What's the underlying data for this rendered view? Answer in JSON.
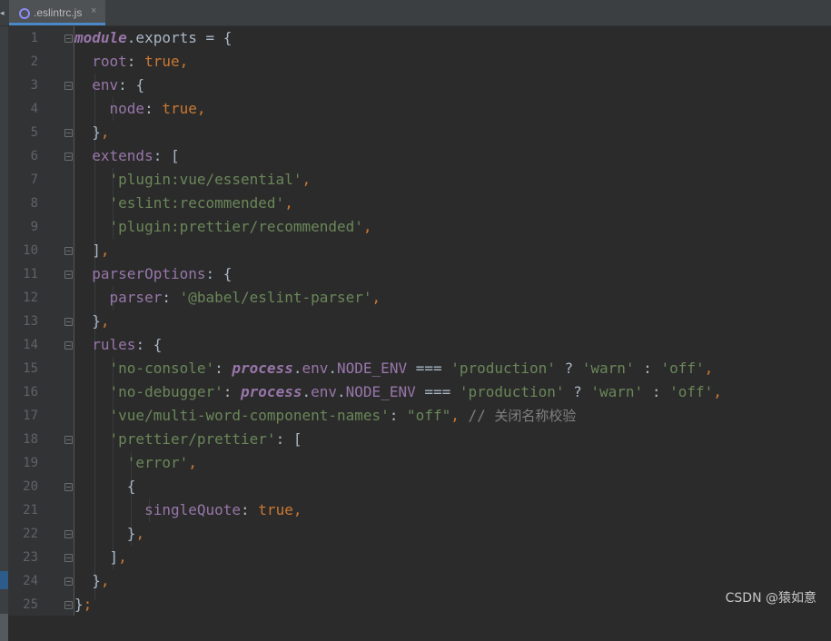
{
  "tab": {
    "filename": ".eslintrc.js",
    "close": "×",
    "icon": "eslint-config-icon"
  },
  "watermark": "CSDN @猿如意",
  "colors": {
    "keyword": "#cc7832",
    "string": "#6a8759",
    "property": "#9876aa",
    "text": "#a9b7c6",
    "comment": "#808080",
    "background": "#2b2b2b"
  },
  "code": {
    "line_numbers": [
      "1",
      "2",
      "3",
      "4",
      "5",
      "6",
      "7",
      "8",
      "9",
      "10",
      "11",
      "12",
      "13",
      "14",
      "15",
      "16",
      "17",
      "18",
      "19",
      "20",
      "21",
      "22",
      "23",
      "24",
      "25"
    ],
    "l1": {
      "obj": "module",
      "rest": ".exports = {"
    },
    "l2": {
      "key": "root",
      "colon": ": ",
      "val": "true",
      "comma": ","
    },
    "l3": {
      "key": "env",
      "rest": ": {"
    },
    "l4": {
      "key": "node",
      "colon": ": ",
      "val": "true",
      "comma": ","
    },
    "l5": {
      "brace": "}",
      "comma": ","
    },
    "l6": {
      "key": "extends",
      "rest": ": ["
    },
    "l7": {
      "str": "'plugin:vue/essential'",
      "comma": ","
    },
    "l8": {
      "str": "'eslint:recommended'",
      "comma": ","
    },
    "l9": {
      "str": "'plugin:prettier/recommended'",
      "comma": ","
    },
    "l10": {
      "brace": "]",
      "comma": ","
    },
    "l11": {
      "key": "parserOptions",
      "rest": ": {"
    },
    "l12": {
      "key": "parser",
      "colon": ": ",
      "str": "'@babel/eslint-parser'",
      "comma": ","
    },
    "l13": {
      "brace": "}",
      "comma": ","
    },
    "l14": {
      "key": "rules",
      "rest": ": {"
    },
    "l15": {
      "rule": "'no-console'",
      "colon": ": ",
      "obj": "process",
      "dot1": ".",
      "env": "env",
      "dot2": ".",
      "nodeenv": "NODE_ENV",
      "op": " === ",
      "prod": "'production'",
      "q": " ? ",
      "warn": "'warn'",
      "c": " : ",
      "off": "'off'",
      "comma": ","
    },
    "l16": {
      "rule": "'no-debugger'",
      "colon": ": ",
      "obj": "process",
      "dot1": ".",
      "env": "env",
      "dot2": ".",
      "nodeenv": "NODE_ENV",
      "op": " === ",
      "prod": "'production'",
      "q": " ? ",
      "warn": "'warn'",
      "c": " : ",
      "off": "'off'",
      "comma": ","
    },
    "l17": {
      "rule": "'vue/multi-word-component-names'",
      "colon": ": ",
      "val": "\"off\"",
      "comma": ",",
      "slash": " // ",
      "comment": "关闭名称校验"
    },
    "l18": {
      "rule": "'prettier/prettier'",
      "rest": ": ["
    },
    "l19": {
      "str": "'error'",
      "comma": ","
    },
    "l20": {
      "brace": "{"
    },
    "l21": {
      "key": "singleQuote",
      "colon": ": ",
      "val": "true",
      "comma": ","
    },
    "l22": {
      "brace": "}",
      "comma": ","
    },
    "l23": {
      "brace": "]",
      "comma": ","
    },
    "l24": {
      "brace": "}",
      "comma": ","
    },
    "l25": {
      "brace": "}",
      "semi": ";"
    }
  }
}
